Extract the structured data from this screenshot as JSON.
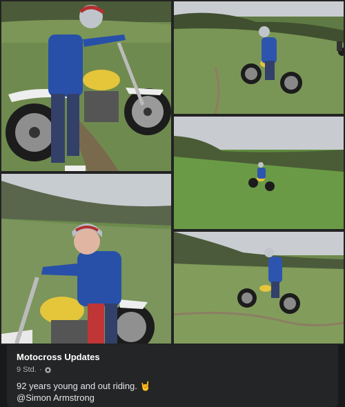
{
  "post": {
    "page_name": "Motocross Updates",
    "time": "9 Std.",
    "separator": "·",
    "audience_icon": "gear-icon",
    "text": "92 years young and out riding. 🤘",
    "mention": "@Simon Armstrong"
  },
  "colors": {
    "background": "#18191a",
    "caption_bg": "#242526",
    "text_primary": "#e4e6eb",
    "text_secondary": "#b0b3b8"
  }
}
